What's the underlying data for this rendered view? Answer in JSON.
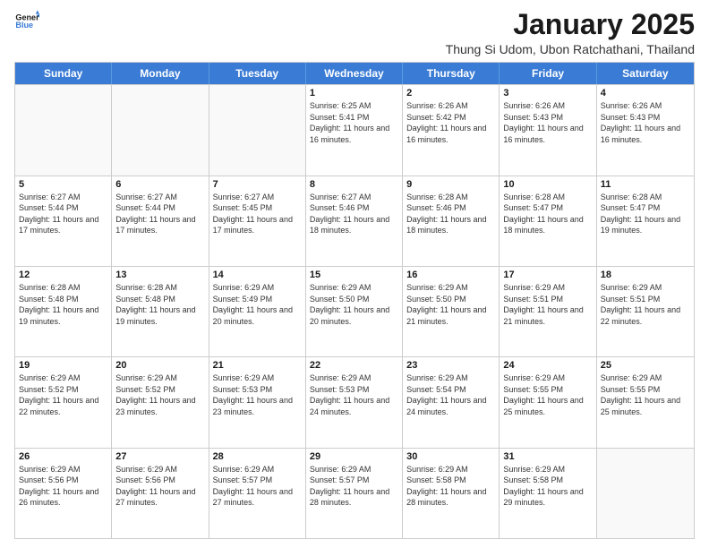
{
  "header": {
    "logo_line1": "General",
    "logo_line2": "Blue",
    "month": "January 2025",
    "location": "Thung Si Udom, Ubon Ratchathani, Thailand"
  },
  "weekdays": [
    "Sunday",
    "Monday",
    "Tuesday",
    "Wednesday",
    "Thursday",
    "Friday",
    "Saturday"
  ],
  "rows": [
    [
      {
        "day": "",
        "info": ""
      },
      {
        "day": "",
        "info": ""
      },
      {
        "day": "",
        "info": ""
      },
      {
        "day": "1",
        "info": "Sunrise: 6:25 AM\nSunset: 5:41 PM\nDaylight: 11 hours and 16 minutes."
      },
      {
        "day": "2",
        "info": "Sunrise: 6:26 AM\nSunset: 5:42 PM\nDaylight: 11 hours and 16 minutes."
      },
      {
        "day": "3",
        "info": "Sunrise: 6:26 AM\nSunset: 5:43 PM\nDaylight: 11 hours and 16 minutes."
      },
      {
        "day": "4",
        "info": "Sunrise: 6:26 AM\nSunset: 5:43 PM\nDaylight: 11 hours and 16 minutes."
      }
    ],
    [
      {
        "day": "5",
        "info": "Sunrise: 6:27 AM\nSunset: 5:44 PM\nDaylight: 11 hours and 17 minutes."
      },
      {
        "day": "6",
        "info": "Sunrise: 6:27 AM\nSunset: 5:44 PM\nDaylight: 11 hours and 17 minutes."
      },
      {
        "day": "7",
        "info": "Sunrise: 6:27 AM\nSunset: 5:45 PM\nDaylight: 11 hours and 17 minutes."
      },
      {
        "day": "8",
        "info": "Sunrise: 6:27 AM\nSunset: 5:46 PM\nDaylight: 11 hours and 18 minutes."
      },
      {
        "day": "9",
        "info": "Sunrise: 6:28 AM\nSunset: 5:46 PM\nDaylight: 11 hours and 18 minutes."
      },
      {
        "day": "10",
        "info": "Sunrise: 6:28 AM\nSunset: 5:47 PM\nDaylight: 11 hours and 18 minutes."
      },
      {
        "day": "11",
        "info": "Sunrise: 6:28 AM\nSunset: 5:47 PM\nDaylight: 11 hours and 19 minutes."
      }
    ],
    [
      {
        "day": "12",
        "info": "Sunrise: 6:28 AM\nSunset: 5:48 PM\nDaylight: 11 hours and 19 minutes."
      },
      {
        "day": "13",
        "info": "Sunrise: 6:28 AM\nSunset: 5:48 PM\nDaylight: 11 hours and 19 minutes."
      },
      {
        "day": "14",
        "info": "Sunrise: 6:29 AM\nSunset: 5:49 PM\nDaylight: 11 hours and 20 minutes."
      },
      {
        "day": "15",
        "info": "Sunrise: 6:29 AM\nSunset: 5:50 PM\nDaylight: 11 hours and 20 minutes."
      },
      {
        "day": "16",
        "info": "Sunrise: 6:29 AM\nSunset: 5:50 PM\nDaylight: 11 hours and 21 minutes."
      },
      {
        "day": "17",
        "info": "Sunrise: 6:29 AM\nSunset: 5:51 PM\nDaylight: 11 hours and 21 minutes."
      },
      {
        "day": "18",
        "info": "Sunrise: 6:29 AM\nSunset: 5:51 PM\nDaylight: 11 hours and 22 minutes."
      }
    ],
    [
      {
        "day": "19",
        "info": "Sunrise: 6:29 AM\nSunset: 5:52 PM\nDaylight: 11 hours and 22 minutes."
      },
      {
        "day": "20",
        "info": "Sunrise: 6:29 AM\nSunset: 5:52 PM\nDaylight: 11 hours and 23 minutes."
      },
      {
        "day": "21",
        "info": "Sunrise: 6:29 AM\nSunset: 5:53 PM\nDaylight: 11 hours and 23 minutes."
      },
      {
        "day": "22",
        "info": "Sunrise: 6:29 AM\nSunset: 5:53 PM\nDaylight: 11 hours and 24 minutes."
      },
      {
        "day": "23",
        "info": "Sunrise: 6:29 AM\nSunset: 5:54 PM\nDaylight: 11 hours and 24 minutes."
      },
      {
        "day": "24",
        "info": "Sunrise: 6:29 AM\nSunset: 5:55 PM\nDaylight: 11 hours and 25 minutes."
      },
      {
        "day": "25",
        "info": "Sunrise: 6:29 AM\nSunset: 5:55 PM\nDaylight: 11 hours and 25 minutes."
      }
    ],
    [
      {
        "day": "26",
        "info": "Sunrise: 6:29 AM\nSunset: 5:56 PM\nDaylight: 11 hours and 26 minutes."
      },
      {
        "day": "27",
        "info": "Sunrise: 6:29 AM\nSunset: 5:56 PM\nDaylight: 11 hours and 27 minutes."
      },
      {
        "day": "28",
        "info": "Sunrise: 6:29 AM\nSunset: 5:57 PM\nDaylight: 11 hours and 27 minutes."
      },
      {
        "day": "29",
        "info": "Sunrise: 6:29 AM\nSunset: 5:57 PM\nDaylight: 11 hours and 28 minutes."
      },
      {
        "day": "30",
        "info": "Sunrise: 6:29 AM\nSunset: 5:58 PM\nDaylight: 11 hours and 28 minutes."
      },
      {
        "day": "31",
        "info": "Sunrise: 6:29 AM\nSunset: 5:58 PM\nDaylight: 11 hours and 29 minutes."
      },
      {
        "day": "",
        "info": ""
      }
    ]
  ]
}
